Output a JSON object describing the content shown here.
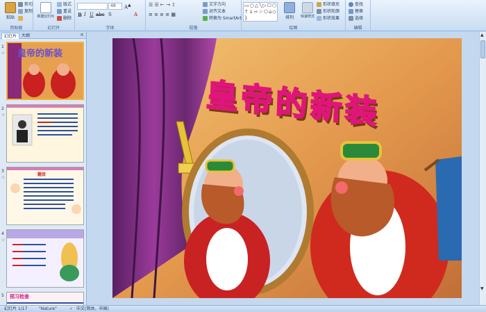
{
  "ribbon": {
    "clipboard": {
      "paste": "粘贴",
      "cut": "剪切",
      "copy": "复制",
      "painter": "格式刷",
      "label": "剪贴板"
    },
    "slides": {
      "new_slide": "新建幻灯片",
      "layout": "版式",
      "reset": "重设",
      "delete": "删除",
      "label": "幻灯片"
    },
    "font": {
      "font_size": "48",
      "label": "字体"
    },
    "paragraph": {
      "text_direction": "文字方向",
      "align_text": "对齐文本",
      "smartart": "转换为 SmartArt",
      "label": "段落"
    },
    "drawing": {
      "arrange": "排列",
      "quick_styles": "快速样式",
      "shape_fill": "形状填充",
      "shape_outline": "形状轮廓",
      "shape_effects": "形状效果",
      "label": "绘图"
    },
    "editing": {
      "find": "查找",
      "replace": "替换",
      "select": "选择",
      "label": "编辑"
    }
  },
  "left_pane": {
    "tabs": [
      "幻灯片",
      "大纲"
    ],
    "close": "×",
    "thumbnails": [
      {
        "num": "1",
        "title": "皇帝的新装"
      },
      {
        "num": "2",
        "title": ""
      },
      {
        "num": "3",
        "title": "题目"
      },
      {
        "num": "4",
        "title": ""
      },
      {
        "num": "5",
        "title": "预习检查"
      }
    ]
  },
  "slide": {
    "title": "皇帝的新装"
  },
  "statusbar": {
    "slide_pos": "幻灯片 1/17",
    "theme": "\"Nature\"",
    "language": "中文(简体，中国)"
  },
  "colors": {
    "title_fill": "#6a4fd0",
    "title_stroke": "#e0157a",
    "selection": "#f4b43a"
  }
}
